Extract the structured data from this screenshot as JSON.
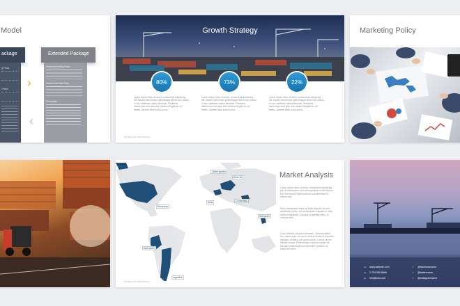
{
  "slide1": {
    "title": "Model",
    "basic_label": "ackage",
    "extended_label": "Extended Package",
    "ext_sections": [
      "Extended Monthly Plans",
      "Extended Annual Plans",
      "Description"
    ],
    "basic_sections": [
      "ly Plans",
      "l Plans"
    ],
    "next_arrow": "›",
    "prev_arrow": "‹"
  },
  "slide2": {
    "title": "Growth Strategy",
    "stats": [
      "80%",
      "73%",
      "22%"
    ],
    "text": "Lorem ipsum dolor sit amet, consectetur adipiscing elit. Mauris elementum pellentesque libero non cursus. In hac habitasse platea dictumst. Phasellus elementum erat quis arcu ultrices fringilla ac vel metus. Aenean vitae luctus purus.",
    "footer": "INVESTOR PROPOSAL"
  },
  "slide3": {
    "title": "Marketing Policy"
  },
  "slide5": {
    "title": "Market Analysis",
    "para1": "Lorem ipsum dolor sit amet, consectetur adipiscing elit. Ut elementum, sed velit eget justo mollis dictum et in leo mauris, eget maximus condimentum in finibus odio.",
    "para2": "Nunc malesuada neque ac tellus blandit, sit nunc sollicitudin purus, non lacinia justo. Aliquam ut nulla eleifend dignissim. Quisque in egestas tellus, ut volutpat arcu.",
    "para3": "Cras molestie volutpat commodo. Vivamus ipsum leo, ullamcorper nec purus viverra tincidunt vulputate volutpat. Vivamus non quam luctus. Cursus vel leo efficitur massa. Pellentesque euismod sapien sit, tincidunt malesuada sed nisi velit et porttitor ac metus ac tellus.",
    "pins": [
      "San ipsum",
      "Lorem ipsum",
      "Dolor sit",
      "Amet",
      "Consectetur",
      "Elementum",
      "Lorem ipsum",
      "Dolor sit",
      "Nisi ipsum",
      "Duis ipsum",
      "Argentina"
    ],
    "footer": "INVESTOR PROPOSAL"
  },
  "slide6": {
    "contacts_left": [
      "www.website.com",
      "1 234 555 6666",
      "info@info.com"
    ],
    "contacts_right": [
      "@facebookname",
      "@twittername",
      "@instagramname"
    ]
  }
}
